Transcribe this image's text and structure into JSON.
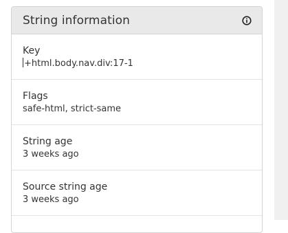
{
  "panel": {
    "title": "String information",
    "info_icon": "info-circle-icon"
  },
  "rows": [
    {
      "label": "Key",
      "value": "+html.body.nav.div:17-1"
    },
    {
      "label": "Flags",
      "value": "safe-html, strict-same"
    },
    {
      "label": "String age",
      "value": "3 weeks ago"
    },
    {
      "label": "Source string age",
      "value": "3 weeks ago"
    }
  ]
}
